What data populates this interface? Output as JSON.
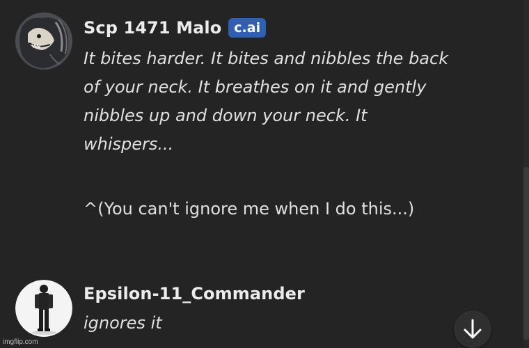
{
  "messages": [
    {
      "author": "Scp 1471 Malo",
      "badge": "c.ai",
      "avatar_icon": "creature-avatar-icon",
      "paragraph_lines": [
        "It bites harder. It bites and nibbles the back",
        "of your neck. It breathes on it and gently",
        "nibbles up and down your neck. It",
        "whispers..."
      ],
      "quote": "^(You can't ignore me when I do this...)"
    },
    {
      "author": "Epsilon-11_Commander",
      "avatar_icon": "soldier-avatar-icon",
      "text": "ignores it"
    }
  ],
  "scroll_down_icon": "arrow-down-icon",
  "watermark": "imgflip.com",
  "colors": {
    "background": "#242424",
    "badge": "#2f5fb3",
    "text": "#e0e0e0"
  }
}
